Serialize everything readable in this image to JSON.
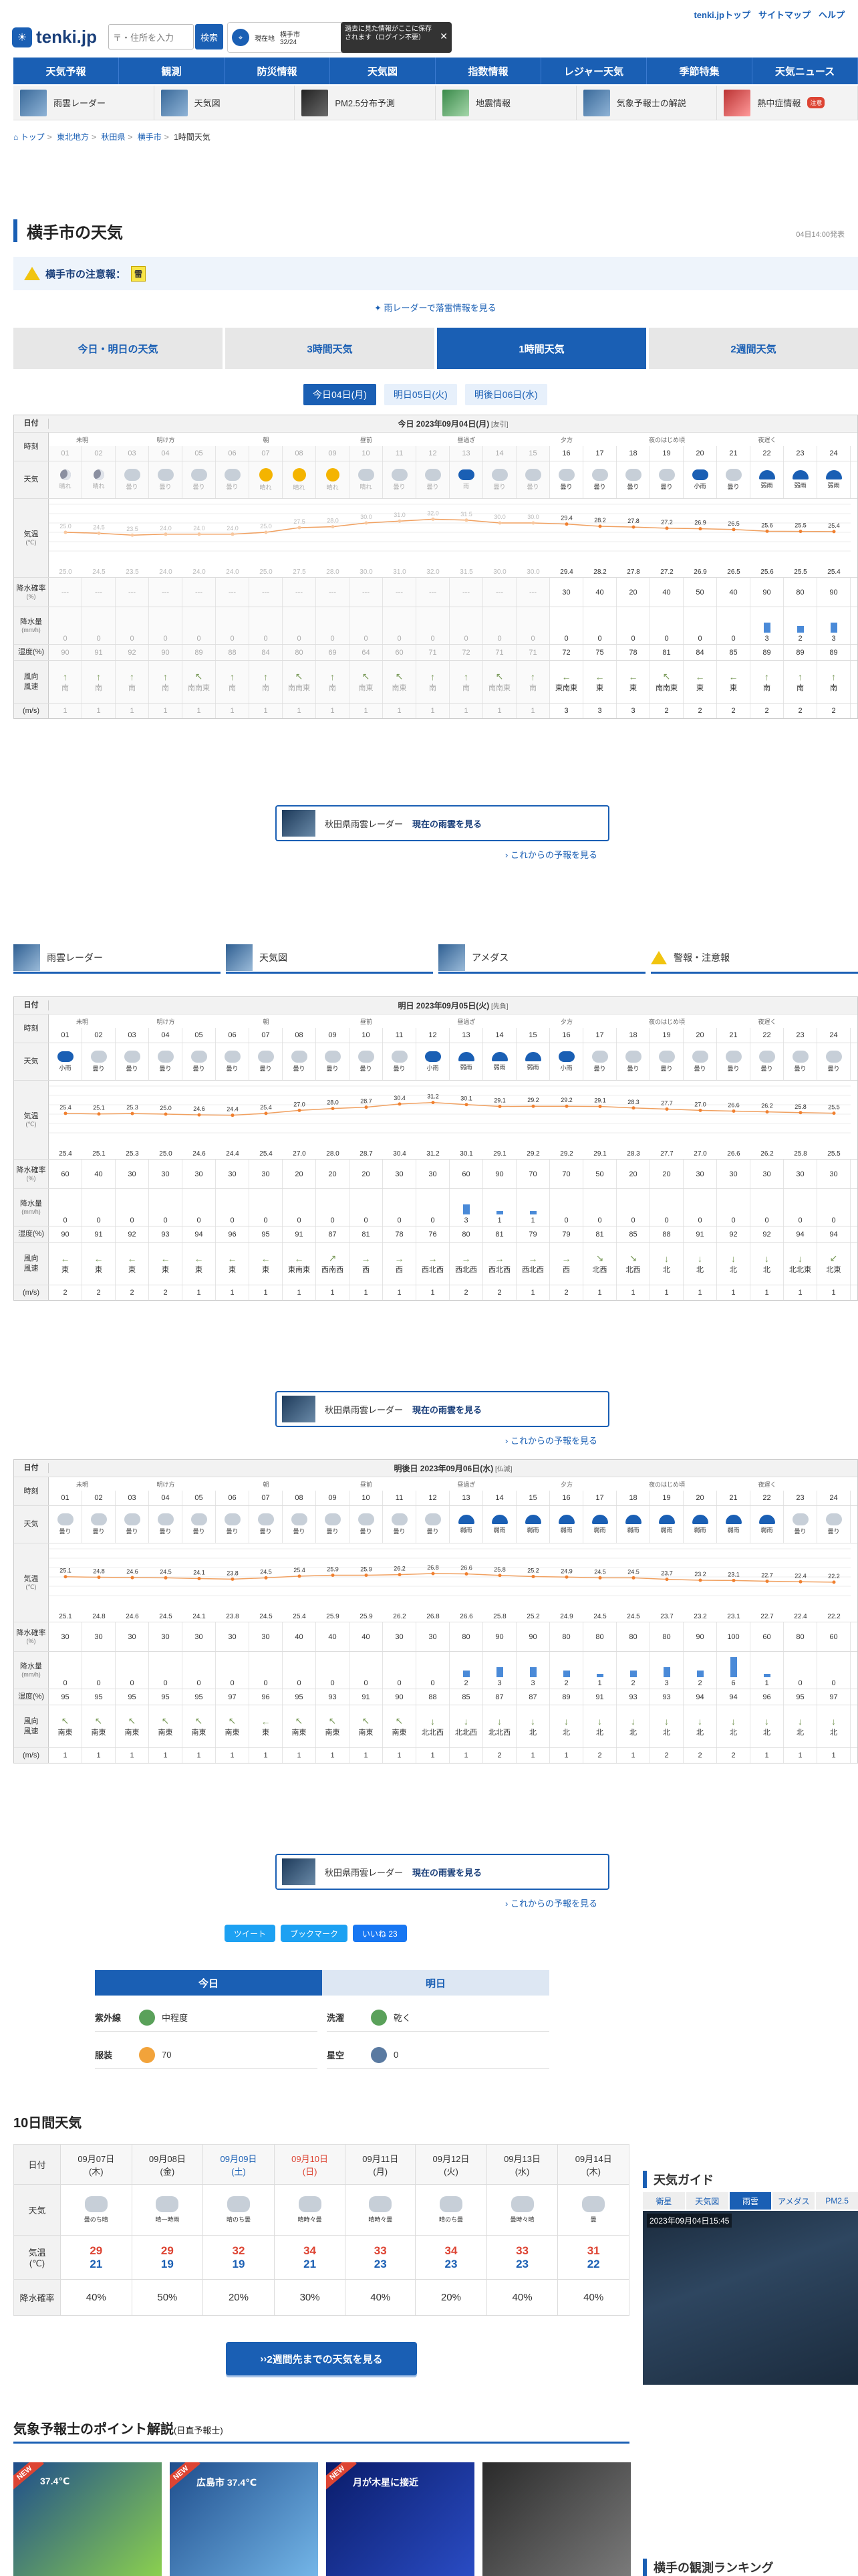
{
  "header": {
    "logo": "tenki.jp",
    "search_placeholder": "〒・住所を入力",
    "search_button": "検索",
    "location_label": "現在地",
    "location_temp_label": "横手市",
    "location_temp": "32/24",
    "tooltip": "過去に見た情報がここに保存されます（ログイン不要）",
    "top_links": [
      "tenki.jpトップ",
      "サイトマップ",
      "ヘルプ"
    ]
  },
  "gnav": [
    "天気予報",
    "観測",
    "防災情報",
    "天気図",
    "指数情報",
    "レジャー天気",
    "季節特集",
    "天気ニュース"
  ],
  "subnav": [
    {
      "label": "雨雲レーダー",
      "thumb": "blue"
    },
    {
      "label": "天気図",
      "thumb": "blue"
    },
    {
      "label": "PM2.5分布予測",
      "thumb": "dark"
    },
    {
      "label": "地震情報",
      "thumb": "green"
    },
    {
      "label": "気象予報士の解説",
      "thumb": "blue"
    },
    {
      "label": "熱中症情報",
      "thumb": "red",
      "badge": "注意"
    }
  ],
  "breadcrumb": [
    "トップ",
    "東北地方",
    "秋田県",
    "横手市",
    "1時間天気"
  ],
  "page_title": "横手市の天気",
  "issued": "04日14:00発表",
  "alert": {
    "label": "横手市の注意報：",
    "badge": "雷"
  },
  "radar_link": "雨レーダーで落雷情報を見る",
  "main_tabs": [
    "今日・明日の天気",
    "3時間天気",
    "1時間天気",
    "2週間天気"
  ],
  "day_tabs": [
    "今日04日(月)",
    "明日05日(火)",
    "明後日06日(水)"
  ],
  "row_labels": {
    "date": "日付",
    "time": "時刻",
    "weather": "天気",
    "temp": "気温",
    "temp_unit": "(℃)",
    "precip_prob": "降水確率",
    "precip_prob_unit": "(%)",
    "precip_amt": "降水量",
    "precip_amt_unit": "(mm/h)",
    "humidity": "湿度(%)",
    "wind_dir": "風向",
    "wind_speed": "風速",
    "wind_unit": "(m/s)"
  },
  "periods": [
    "未明",
    "明け方",
    "朝",
    "昼前",
    "昼過ぎ",
    "夕方",
    "夜のはじめ頃",
    "夜遅く"
  ],
  "hours": [
    "01",
    "02",
    "03",
    "04",
    "05",
    "06",
    "07",
    "08",
    "09",
    "10",
    "11",
    "12",
    "13",
    "14",
    "15",
    "16",
    "17",
    "18",
    "19",
    "20",
    "21",
    "22",
    "23",
    "24"
  ],
  "days": [
    {
      "title": "今日 2023年09月04日(月)",
      "rokuyo": "[友引]",
      "past_count": 15,
      "weather": [
        "晴れ",
        "晴れ",
        "曇り",
        "曇り",
        "曇り",
        "曇り",
        "晴れ",
        "晴れ",
        "晴れ",
        "晴れ",
        "曇り",
        "曇り",
        "雨",
        "曇り",
        "曇り",
        "曇り",
        "曇り",
        "曇り",
        "曇り",
        "小雨",
        "曇り",
        "弱雨",
        "弱雨",
        "弱雨"
      ],
      "icons": [
        "moon",
        "moon",
        "cloud",
        "cloud",
        "cloud",
        "cloud",
        "sun",
        "sun",
        "sun",
        "cloud",
        "cloud",
        "cloud",
        "rain",
        "cloud",
        "cloud",
        "cloud",
        "cloud",
        "cloud",
        "cloud",
        "rain",
        "cloud",
        "umbrella",
        "umbrella",
        "umbrella"
      ],
      "temps": [
        25.0,
        24.5,
        23.5,
        24.0,
        24.0,
        24.0,
        25.0,
        27.5,
        28.0,
        30.0,
        31.0,
        32.0,
        31.5,
        30.0,
        30.0,
        29.4,
        28.2,
        27.8,
        27.2,
        26.9,
        26.5,
        25.6,
        25.5,
        25.4
      ],
      "precip_prob": [
        "---",
        "---",
        "---",
        "---",
        "---",
        "---",
        "---",
        "---",
        "---",
        "---",
        "---",
        "---",
        "---",
        "---",
        "---",
        "30",
        "40",
        "20",
        "40",
        "50",
        "40",
        "90",
        "80",
        "90"
      ],
      "precip_amt": [
        0,
        0,
        0,
        0,
        0,
        0,
        0,
        0,
        0,
        0,
        0,
        0,
        0,
        0,
        0,
        0,
        0,
        0,
        0,
        0,
        0,
        3,
        2,
        3
      ],
      "humidity": [
        90,
        91,
        92,
        90,
        89,
        88,
        84,
        80,
        69,
        64,
        60,
        71,
        72,
        71,
        71,
        72,
        75,
        78,
        81,
        84,
        85,
        89,
        89,
        89
      ],
      "wind_dir": [
        "南",
        "南",
        "南",
        "南",
        "南南東",
        "南",
        "南",
        "南南東",
        "南",
        "南東",
        "南東",
        "南",
        "南",
        "南南東",
        "南",
        "東南東",
        "東",
        "東",
        "南南東",
        "東",
        "東",
        "南",
        "南",
        "南"
      ],
      "wind_speed": [
        1,
        1,
        1,
        1,
        1,
        1,
        1,
        1,
        1,
        1,
        1,
        1,
        1,
        1,
        1,
        3,
        3,
        3,
        2,
        2,
        2,
        2,
        2,
        2
      ]
    },
    {
      "title": "明日 2023年09月05日(火)",
      "rokuyo": "[先負]",
      "past_count": 0,
      "weather": [
        "小雨",
        "曇り",
        "曇り",
        "曇り",
        "曇り",
        "曇り",
        "曇り",
        "曇り",
        "曇り",
        "曇り",
        "曇り",
        "小雨",
        "弱雨",
        "弱雨",
        "弱雨",
        "小雨",
        "曇り",
        "曇り",
        "曇り",
        "曇り",
        "曇り",
        "曇り",
        "曇り",
        "曇り"
      ],
      "icons": [
        "rain",
        "cloud",
        "cloud",
        "cloud",
        "cloud",
        "cloud",
        "cloud",
        "cloud",
        "cloud",
        "cloud",
        "cloud",
        "rain",
        "umbrella",
        "umbrella",
        "umbrella",
        "rain",
        "cloud",
        "cloud",
        "cloud",
        "cloud",
        "cloud",
        "cloud",
        "cloud",
        "cloud"
      ],
      "temps": [
        25.4,
        25.1,
        25.3,
        25.0,
        24.6,
        24.4,
        25.4,
        27.0,
        28.0,
        28.7,
        30.4,
        31.2,
        30.1,
        29.1,
        29.2,
        29.2,
        29.1,
        28.3,
        27.7,
        27.0,
        26.6,
        26.2,
        25.8,
        25.5
      ],
      "precip_prob": [
        "60",
        "40",
        "30",
        "30",
        "30",
        "30",
        "30",
        "20",
        "20",
        "20",
        "30",
        "30",
        "60",
        "90",
        "70",
        "70",
        "50",
        "20",
        "20",
        "30",
        "30",
        "30",
        "30",
        "30"
      ],
      "precip_amt": [
        0,
        0,
        0,
        0,
        0,
        0,
        0,
        0,
        0,
        0,
        0,
        0,
        3,
        1,
        1,
        0,
        0,
        0,
        0,
        0,
        0,
        0,
        0,
        0
      ],
      "humidity": [
        90,
        91,
        92,
        93,
        94,
        96,
        95,
        91,
        87,
        81,
        78,
        76,
        80,
        81,
        79,
        79,
        81,
        85,
        88,
        91,
        92,
        92,
        94,
        94
      ],
      "wind_dir": [
        "東",
        "東",
        "東",
        "東",
        "東",
        "東",
        "東",
        "東南東",
        "西南西",
        "西",
        "西",
        "西北西",
        "西北西",
        "西北西",
        "西北西",
        "西",
        "北西",
        "北西",
        "北",
        "北",
        "北",
        "北",
        "北北東",
        "北東"
      ],
      "wind_speed": [
        2,
        2,
        2,
        2,
        1,
        1,
        1,
        1,
        1,
        1,
        1,
        1,
        2,
        2,
        1,
        2,
        1,
        1,
        1,
        1,
        1,
        1,
        1,
        1
      ]
    },
    {
      "title": "明後日 2023年09月06日(水)",
      "rokuyo": "[仏滅]",
      "past_count": 0,
      "weather": [
        "曇り",
        "曇り",
        "曇り",
        "曇り",
        "曇り",
        "曇り",
        "曇り",
        "曇り",
        "曇り",
        "曇り",
        "曇り",
        "曇り",
        "弱雨",
        "弱雨",
        "弱雨",
        "弱雨",
        "弱雨",
        "弱雨",
        "弱雨",
        "弱雨",
        "弱雨",
        "弱雨",
        "曇り",
        "曇り"
      ],
      "icons": [
        "cloud",
        "cloud",
        "cloud",
        "cloud",
        "cloud",
        "cloud",
        "cloud",
        "cloud",
        "cloud",
        "cloud",
        "cloud",
        "cloud",
        "umbrella",
        "umbrella",
        "umbrella",
        "umbrella",
        "umbrella",
        "umbrella",
        "umbrella",
        "umbrella",
        "umbrella",
        "umbrella",
        "cloud",
        "cloud"
      ],
      "temps": [
        25.1,
        24.8,
        24.6,
        24.5,
        24.1,
        23.8,
        24.5,
        25.4,
        25.9,
        25.9,
        26.2,
        26.8,
        26.6,
        25.8,
        25.2,
        24.9,
        24.5,
        24.5,
        23.7,
        23.2,
        23.1,
        22.7,
        22.4,
        22.2
      ],
      "precip_prob": [
        "30",
        "30",
        "30",
        "30",
        "30",
        "30",
        "30",
        "40",
        "40",
        "40",
        "30",
        "30",
        "80",
        "90",
        "90",
        "80",
        "80",
        "80",
        "80",
        "90",
        "100",
        "60",
        "80",
        "60"
      ],
      "precip_amt": [
        0,
        0,
        0,
        0,
        0,
        0,
        0,
        0,
        0,
        0,
        0,
        0,
        2,
        3,
        3,
        2,
        1,
        2,
        3,
        2,
        6,
        1,
        0,
        0
      ],
      "humidity": [
        95,
        95,
        95,
        95,
        95,
        97,
        96,
        95,
        93,
        91,
        90,
        88,
        85,
        87,
        87,
        89,
        91,
        93,
        93,
        94,
        94,
        96,
        95,
        97
      ],
      "wind_dir": [
        "南東",
        "南東",
        "南東",
        "南東",
        "南東",
        "南東",
        "東",
        "南東",
        "南東",
        "南東",
        "南東",
        "北北西",
        "北北西",
        "北北西",
        "北",
        "北",
        "北",
        "北",
        "北",
        "北",
        "北",
        "北",
        "北",
        "北"
      ],
      "wind_speed": [
        1,
        1,
        1,
        1,
        1,
        1,
        1,
        1,
        1,
        1,
        1,
        1,
        1,
        2,
        1,
        1,
        2,
        1,
        2,
        2,
        2,
        1,
        1,
        1
      ]
    }
  ],
  "radar_banner": {
    "prefix": "秋田県雨雲レーダー",
    "label": "現在の雨雲を見る"
  },
  "more_forecast": "これからの予報を見る",
  "map_nav": [
    "雨雲レーダー",
    "天気図",
    "アメダス",
    "警報・注意報"
  ],
  "share": {
    "tweet": "ツイート",
    "like": "いいね 23",
    "bookmark": "ブックマーク"
  },
  "index_tabs": [
    "今日",
    "明日"
  ],
  "indexes": [
    {
      "label": "紫外線",
      "value": "中程度",
      "icon": "g"
    },
    {
      "label": "洗濯",
      "value": "乾く",
      "icon": "g"
    },
    {
      "label": "服装",
      "value": "70",
      "icon": "o"
    },
    {
      "label": "星空",
      "value": "0",
      "icon": "b"
    }
  ],
  "week": {
    "title": "10日間天気",
    "labels": {
      "date": "日付",
      "weather": "天気",
      "temp": "気温",
      "temp_unit": "(℃)",
      "precip": "降水確率"
    },
    "days": [
      {
        "date": "09月07日",
        "dow": "(木)",
        "cls": "",
        "wx": "曇のち晴",
        "hi": "29",
        "lo": "21",
        "precip": "40%"
      },
      {
        "date": "09月08日",
        "dow": "(金)",
        "cls": "",
        "wx": "晴一時雨",
        "hi": "29",
        "lo": "19",
        "precip": "50%"
      },
      {
        "date": "09月09日",
        "dow": "(土)",
        "cls": "w-sat",
        "wx": "晴のち曇",
        "hi": "32",
        "lo": "19",
        "precip": "20%"
      },
      {
        "date": "09月10日",
        "dow": "(日)",
        "cls": "w-sun",
        "wx": "晴時々曇",
        "hi": "34",
        "lo": "21",
        "precip": "30%"
      },
      {
        "date": "09月11日",
        "dow": "(月)",
        "cls": "",
        "wx": "晴時々曇",
        "hi": "33",
        "lo": "23",
        "precip": "40%"
      },
      {
        "date": "09月12日",
        "dow": "(火)",
        "cls": "",
        "wx": "晴のち曇",
        "hi": "34",
        "lo": "23",
        "precip": "20%"
      },
      {
        "date": "09月13日",
        "dow": "(水)",
        "cls": "",
        "wx": "曇時々晴",
        "hi": "33",
        "lo": "23",
        "precip": "40%"
      },
      {
        "date": "09月14日",
        "dow": "(木)",
        "cls": "",
        "wx": "曇",
        "hi": "31",
        "lo": "22",
        "precip": "40%"
      }
    ],
    "button": "2週間先までの天気を見る"
  },
  "guide": {
    "title": "天気ガイド",
    "tabs": [
      "衛星",
      "天気図",
      "雨雲",
      "アメダス",
      "PM2.5"
    ],
    "time": "2023年09月04日15:45"
  },
  "point": {
    "title": "気象予報士のポイント解説",
    "sub": "(日直予報士)",
    "cards": [
      {
        "caption": "37.4℃",
        "cls": "a",
        "new": true
      },
      {
        "caption": "広島市 37.4℃",
        "cls": "b",
        "new": true
      },
      {
        "caption": "月が木星に接近",
        "cls": "c",
        "new": true
      },
      {
        "caption": "",
        "cls": "d",
        "new": false
      }
    ]
  },
  "ranking_title": "横手の観測ランキング",
  "colors": {
    "primary": "#1a5fb4",
    "hi": "#d43",
    "lo": "#1a5fb4",
    "rainbar": "#4a8ad8"
  }
}
